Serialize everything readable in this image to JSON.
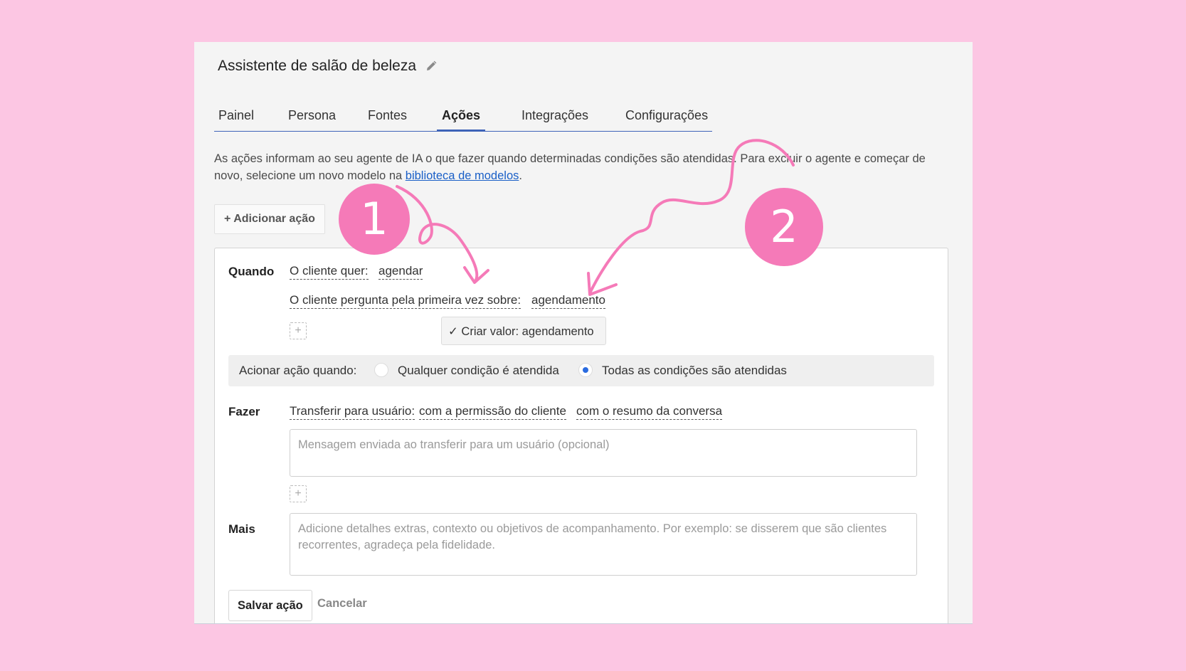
{
  "app": {
    "title": "Assistente de salão de beleza"
  },
  "tabs": [
    {
      "label": "Painel",
      "active": false
    },
    {
      "label": "Persona",
      "active": false
    },
    {
      "label": "Fontes",
      "active": false
    },
    {
      "label": "Ações",
      "active": true
    },
    {
      "label": "Integrações",
      "active": false
    },
    {
      "label": "Configurações",
      "active": false
    }
  ],
  "description": {
    "text_before_link": "As ações informam ao seu agente de IA o que fazer quando determinadas condições são atendidas. Para excluir o agente e começar de novo, selecione um novo modelo na ",
    "link_text": "biblioteca de modelos",
    "text_after_link": "."
  },
  "add_action_button": "+ Adicionar ação",
  "when": {
    "label": "Quando",
    "conditions": [
      {
        "key": "O cliente quer:",
        "value": "agendar"
      },
      {
        "key": "O cliente pergunta pela primeira vez sobre:",
        "value": "agendamento"
      }
    ],
    "add_condition": "+",
    "dropdown_option": "✓ Criar valor: agendamento"
  },
  "trigger": {
    "label": "Acionar ação quando:",
    "options": [
      {
        "label": "Qualquer condição é atendida",
        "checked": false
      },
      {
        "label": "Todas as condições são atendidas",
        "checked": true
      }
    ]
  },
  "do": {
    "label": "Fazer",
    "action": "Transferir para usuário:",
    "modifiers": [
      "com a permissão do cliente",
      "com o resumo da conversa"
    ],
    "message_placeholder": "Mensagem enviada ao transferir para um usuário (opcional)",
    "add_step": "+"
  },
  "more": {
    "label": "Mais",
    "placeholder": "Adicione detalhes extras, contexto ou objetivos de acompanhamento. Por exemplo: se disserem que são clientes recorrentes, agradeça pela fidelidade."
  },
  "footer": {
    "save": "Salvar ação",
    "cancel": "Cancelar"
  },
  "annotations": {
    "badge_1": "1",
    "badge_2": "2",
    "color": "#f57ab8"
  },
  "colors": {
    "background": "#fcc6e3",
    "accent": "#3e63b8",
    "link": "#1a5fc7",
    "radio": "#2a6be0"
  }
}
